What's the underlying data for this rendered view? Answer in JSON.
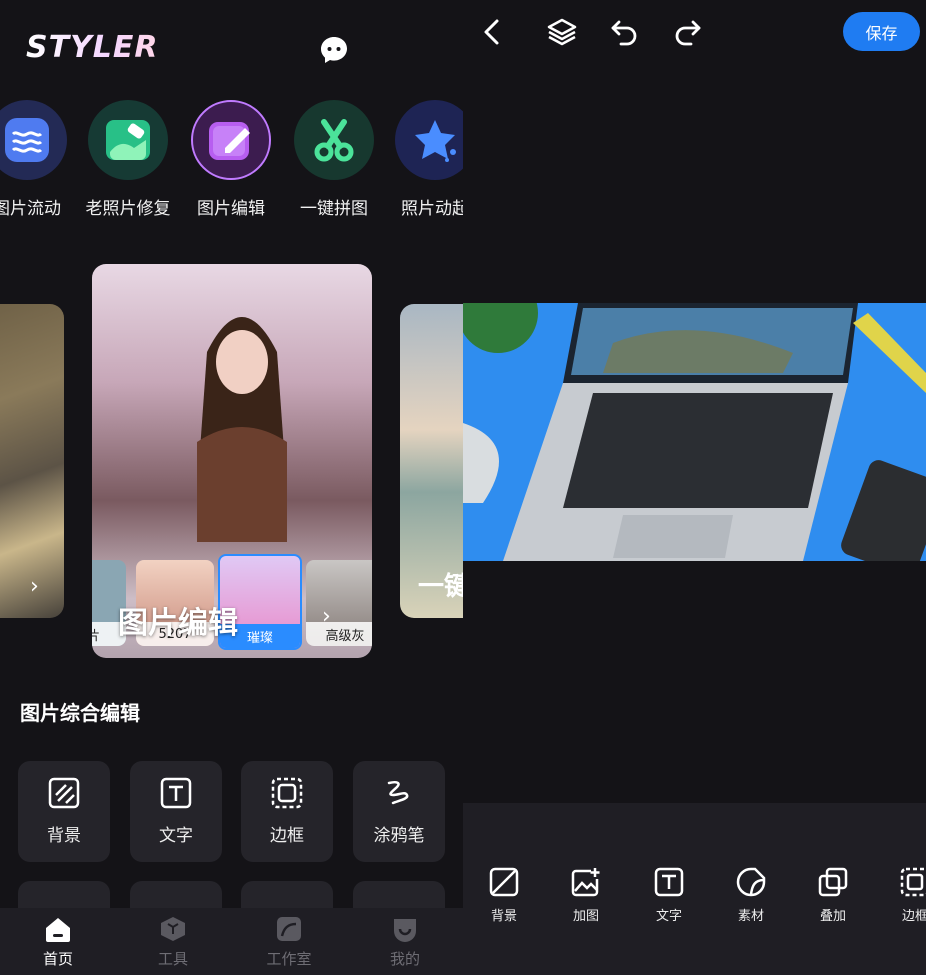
{
  "left_panel": {
    "logo": "STYLER",
    "tools": [
      {
        "label": "图片流动",
        "icon": "waves-icon"
      },
      {
        "label": "老照片修复",
        "icon": "photo-repair-icon"
      },
      {
        "label": "图片编辑",
        "icon": "edit-image-icon"
      },
      {
        "label": "一键拼图",
        "icon": "scissors-icon"
      },
      {
        "label": "照片动起",
        "icon": "star-icon"
      }
    ],
    "carousel": {
      "main_title": "图片编辑",
      "right_card_text": "一键",
      "thumbnails": [
        "效片",
        "5207",
        "璀璨",
        "高级灰"
      ]
    },
    "section_title": "图片综合编辑",
    "grid": [
      {
        "label": "背景",
        "icon": "background-icon"
      },
      {
        "label": "文字",
        "icon": "text-icon"
      },
      {
        "label": "边框",
        "icon": "border-icon"
      },
      {
        "label": "涂鸦笔",
        "icon": "doodle-pen-icon"
      }
    ],
    "bottom_nav": [
      {
        "label": "首页",
        "icon": "home-icon",
        "active": true
      },
      {
        "label": "工具",
        "icon": "tools-icon",
        "active": false
      },
      {
        "label": "工作室",
        "icon": "studio-icon",
        "active": false
      },
      {
        "label": "我的",
        "icon": "profile-icon",
        "active": false
      }
    ]
  },
  "right_panel": {
    "top_bar": {
      "icons": [
        "back-icon",
        "layers-icon",
        "undo-icon",
        "redo-icon"
      ],
      "save_label": "保存"
    },
    "bottom_tools": [
      {
        "label": "背景",
        "icon": "background-icon"
      },
      {
        "label": "加图",
        "icon": "add-image-icon"
      },
      {
        "label": "文字",
        "icon": "text-icon"
      },
      {
        "label": "素材",
        "icon": "sticker-icon"
      },
      {
        "label": "叠加",
        "icon": "overlay-icon"
      },
      {
        "label": "边框",
        "icon": "border-icon"
      }
    ]
  },
  "colors": {
    "background": "#141317",
    "panel": "#1f1e24",
    "accent": "#1f7cf2"
  }
}
